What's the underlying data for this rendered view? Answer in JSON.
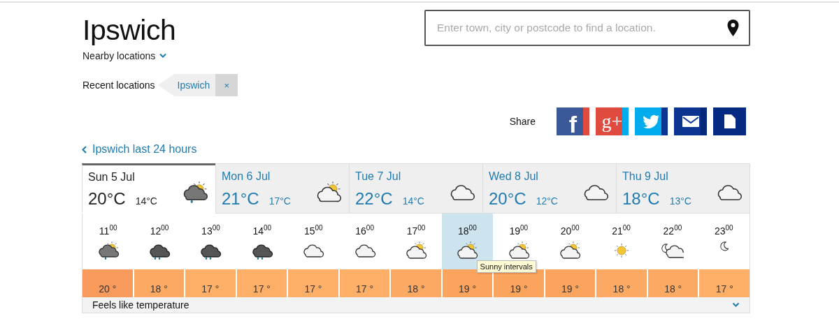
{
  "location": {
    "title": "Ipswich",
    "nearby": "Nearby locations"
  },
  "search": {
    "placeholder": "Enter town, city or postcode to find a location."
  },
  "recent": {
    "label": "Recent locations",
    "items": [
      {
        "name": "Ipswich",
        "remove": "×"
      }
    ]
  },
  "share": {
    "label": "Share",
    "buttons": [
      {
        "kind": "facebook",
        "glyph": "f"
      },
      {
        "kind": "googleplus",
        "glyph": "g+"
      },
      {
        "kind": "twitter"
      },
      {
        "kind": "email"
      },
      {
        "kind": "document"
      }
    ]
  },
  "back_link": "Ipswich last 24 hours",
  "days": [
    {
      "date": "Sun 5 Jul",
      "high": "20°C",
      "low": "14°C",
      "kind": "sun-cloud-rain",
      "selected": true
    },
    {
      "date": "Mon 6 Jul",
      "high": "21°C",
      "low": "17°C",
      "kind": "sun-cloud",
      "selected": false
    },
    {
      "date": "Tue 7 Jul",
      "high": "22°C",
      "low": "14°C",
      "kind": "cloud",
      "selected": false
    },
    {
      "date": "Wed 8 Jul",
      "high": "20°C",
      "low": "12°C",
      "kind": "cloud",
      "selected": false
    },
    {
      "date": "Thu 9 Jul",
      "high": "18°C",
      "low": "13°C",
      "kind": "cloud",
      "selected": false
    }
  ],
  "hours": [
    {
      "time": "11$^{00}$",
      "kind": "sun-cloud-rain",
      "temp": "20 °",
      "color": "#f79a5b",
      "selected": false
    },
    {
      "time": "12$^{00}$",
      "kind": "rain",
      "temp": "18 °",
      "color": "#fcaa63",
      "selected": false
    },
    {
      "time": "13$^{00}$",
      "kind": "rain",
      "temp": "17 °",
      "color": "#fdaf67",
      "selected": false
    },
    {
      "time": "14$^{00}$",
      "kind": "rain",
      "temp": "17 °",
      "color": "#fdaf67",
      "selected": false
    },
    {
      "time": "15$^{00}$",
      "kind": "cloud",
      "temp": "17 °",
      "color": "#fdaf67",
      "selected": false
    },
    {
      "time": "16$^{00}$",
      "kind": "cloud",
      "temp": "17 °",
      "color": "#fdaf67",
      "selected": false
    },
    {
      "time": "17$^{00}$",
      "kind": "sun-cloud",
      "temp": "18 °",
      "color": "#fcaa63",
      "selected": false
    },
    {
      "time": "18$^{00}$",
      "kind": "sun-cloud",
      "temp": "19 °",
      "color": "#fba45e",
      "selected": true,
      "tooltip": "Sunny intervals"
    },
    {
      "time": "19$^{00}$",
      "kind": "sun-cloud",
      "temp": "19 °",
      "color": "#fba45e",
      "selected": false
    },
    {
      "time": "20$^{00}$",
      "kind": "sun-cloud",
      "temp": "19 °",
      "color": "#fba45e",
      "selected": false
    },
    {
      "time": "21$^{00}$",
      "kind": "sun",
      "temp": "18 °",
      "color": "#fcaa63",
      "selected": false
    },
    {
      "time": "22$^{00}$",
      "kind": "moon-cloud",
      "temp": "18 °",
      "color": "#fcaa63",
      "selected": false
    },
    {
      "time": "23$^{00}$",
      "kind": "moon",
      "temp": "17 °",
      "color": "#fdaf67",
      "selected": false
    }
  ],
  "feels_like": {
    "label": "Feels like temperature",
    "expanded": false
  }
}
